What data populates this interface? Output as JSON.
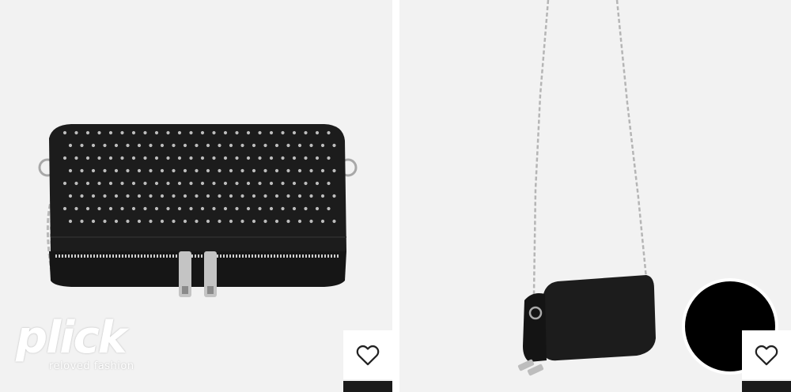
{
  "brand": {
    "logo_word": "plick",
    "logo_tagline": "reloved fashion"
  },
  "products": [
    {
      "image_subject": "black studded crossbody clutch with chain strap",
      "wishlist_icon": "heart-outline-icon"
    },
    {
      "image_subject": "black crossbody bag with long chain strap",
      "wishlist_icon": "heart-outline-icon"
    }
  ],
  "colors": {
    "card_background": "#f2f2f2",
    "bag": "#1c1c1c",
    "hardware": "#b9b9b9",
    "overlay_circle": "#000000"
  }
}
